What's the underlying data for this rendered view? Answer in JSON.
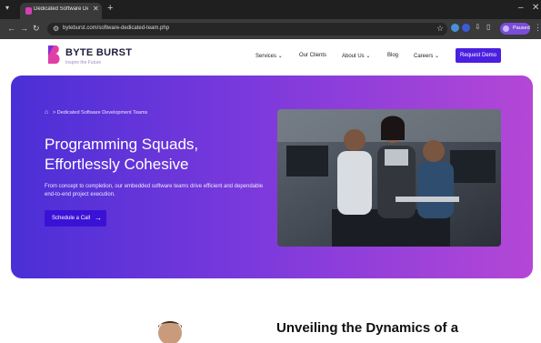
{
  "browser": {
    "tab_title": "Dedicated Software Developm",
    "url": "byteburst.com/software-dedicated-team.php",
    "profile_label": "Paused"
  },
  "header": {
    "brand_name": "BYTE BURST",
    "brand_tagline": "Inspire the Future",
    "nav": [
      {
        "label": "Services",
        "has_dropdown": true
      },
      {
        "label": "Our Clients",
        "has_dropdown": false
      },
      {
        "label": "About Us",
        "has_dropdown": true
      },
      {
        "label": "Blog",
        "has_dropdown": false
      },
      {
        "label": "Careers",
        "has_dropdown": true
      }
    ],
    "cta_label": "Request Demo"
  },
  "hero": {
    "breadcrumb": "> Dedicated Software Development Teams",
    "title_line1": "Programming Squads,",
    "title_line2": "Effortlessly Cohesive",
    "description": "From concept to completion, our embedded software teams drive efficient and dependable end-to-end project execution.",
    "button_label": "Schedule a Call"
  },
  "section": {
    "title": "Unveiling the Dynamics of a"
  },
  "colors": {
    "brand_primary": "#4b1fe0",
    "hero_gradient_start": "#4a2fd6",
    "hero_gradient_end": "#b447d6",
    "logo_pink": "#e03fa6"
  }
}
